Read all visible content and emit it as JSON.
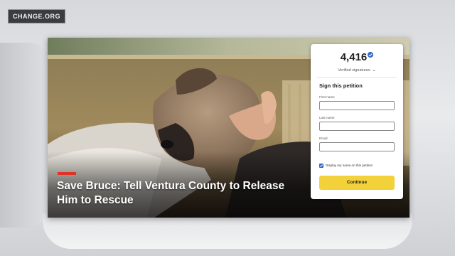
{
  "broadcast": {
    "bug_label": "CHANGE.ORG"
  },
  "petition": {
    "title": "Save Bruce: Tell Ventura County to Release Him to Rescue",
    "photo_icon": "dog-photo",
    "accent_color": "#e13227"
  },
  "signature_card": {
    "count": "4,416",
    "count_icon": "verified-badge-icon",
    "verified_label": "Verified signatures",
    "sign_heading": "Sign this petition",
    "fields": [
      {
        "label": "First name",
        "value": ""
      },
      {
        "label": "Last name",
        "value": ""
      },
      {
        "label": "Email",
        "value": ""
      }
    ],
    "display_checkbox_label": "Display my name on this petition",
    "display_checkbox_checked": true,
    "continue_label": "Continue",
    "button_color": "#f3d13a"
  }
}
